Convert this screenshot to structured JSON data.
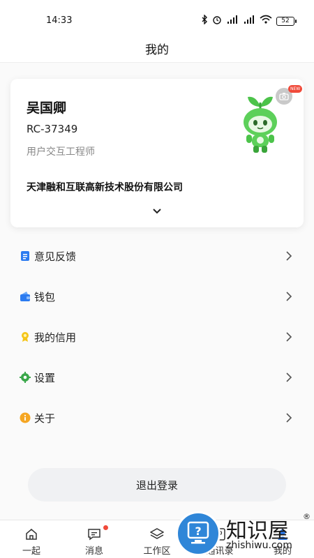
{
  "status_bar": {
    "time": "14:33",
    "battery": "52",
    "icons": [
      "bluetooth-icon",
      "alarm-icon",
      "signal-hd-icon",
      "signal-hd-icon",
      "wifi-icon",
      "battery-icon"
    ]
  },
  "header": {
    "title": "我的"
  },
  "profile": {
    "name": "吴国卿",
    "id": "RC-37349",
    "role": "用户交互工程师",
    "company": "天津融和互联高新技术股份有限公司",
    "new_badge": "NEW"
  },
  "menu": [
    {
      "label": "意见反馈",
      "icon": "feedback-icon",
      "color": "#2b7bf0"
    },
    {
      "label": "钱包",
      "icon": "wallet-icon",
      "color": "#2b7bf0"
    },
    {
      "label": "我的信用",
      "icon": "credit-badge-icon",
      "color": "#f5c518"
    },
    {
      "label": "设置",
      "icon": "gear-icon",
      "color": "#3aa74a"
    },
    {
      "label": "关于",
      "icon": "info-icon",
      "color": "#f5a623"
    }
  ],
  "logout": {
    "label": "退出登录"
  },
  "tabs": [
    {
      "label": "一起",
      "icon": "home-icon"
    },
    {
      "label": "消息",
      "icon": "message-icon"
    },
    {
      "label": "工作区",
      "icon": "layers-icon"
    },
    {
      "label": "通讯录",
      "icon": "contacts-icon"
    },
    {
      "label": "我的",
      "icon": "user-icon"
    }
  ],
  "watermark": {
    "title": "知识屋",
    "domain": "zhishiwu.com",
    "reg": "®"
  }
}
